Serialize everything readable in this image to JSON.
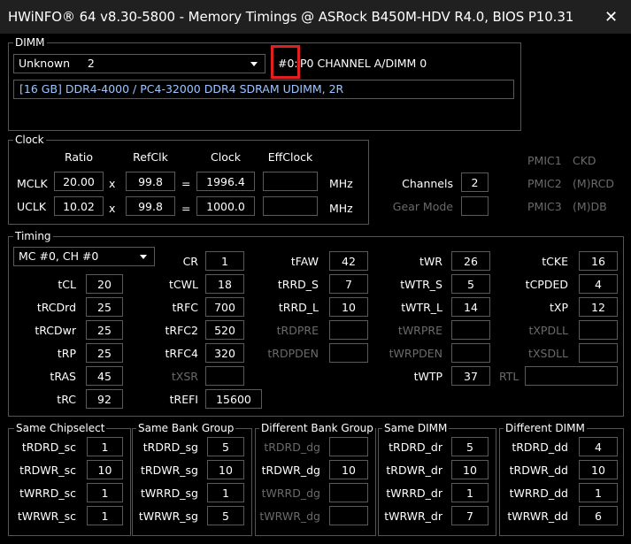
{
  "window": {
    "title": "HWiNFO® 64 v8.30-5800 - Memory Timings @ ASRock B450M-HDV R4.0, BIOS P10.31"
  },
  "dimm": {
    "group_label": "DIMM",
    "select_value": "Unknown     2",
    "slot_id": "#0:",
    "slot_name": "P0 CHANNEL A/DIMM 0",
    "info": "[16 GB] DDR4-4000 / PC4-32000 DDR4 SDRAM UDIMM, 2R"
  },
  "clock": {
    "group_label": "Clock",
    "headers": {
      "ratio": "Ratio",
      "refclk": "RefClk",
      "clock": "Clock",
      "effclock": "EffClock"
    },
    "mclk": {
      "label": "MCLK",
      "ratio": "20.00",
      "refclk": "99.8",
      "clock": "1996.4",
      "effclock": "",
      "unit": "MHz"
    },
    "uclk": {
      "label": "UCLK",
      "ratio": "10.02",
      "refclk": "99.8",
      "clock": "1000.0",
      "effclock": "",
      "unit": "MHz"
    },
    "x": "x",
    "eq": "=",
    "channels_label": "Channels",
    "channels_value": "2",
    "gear_label": "Gear Mode",
    "gear_value": "",
    "pmic1": "PMIC1",
    "pmic1_val": "CKD",
    "pmic2": "PMIC2",
    "pmic2_val": "(M)RCD",
    "pmic3": "PMIC3",
    "pmic3_val": "(M)DB"
  },
  "timing": {
    "group_label": "Timing",
    "mc_select": "MC #0, CH #0",
    "col1": [
      {
        "label": "tCL",
        "value": "20"
      },
      {
        "label": "tRCDrd",
        "value": "25"
      },
      {
        "label": "tRCDwr",
        "value": "25"
      },
      {
        "label": "tRP",
        "value": "25"
      },
      {
        "label": "tRAS",
        "value": "45"
      },
      {
        "label": "tRC",
        "value": "92"
      }
    ],
    "col2": [
      {
        "label": "CR",
        "value": "1"
      },
      {
        "label": "tCWL",
        "value": "18"
      },
      {
        "label": "tRFC",
        "value": "700"
      },
      {
        "label": "tRFC2",
        "value": "520"
      },
      {
        "label": "tRFC4",
        "value": "320"
      },
      {
        "label": "tXSR",
        "value": ""
      },
      {
        "label": "tREFI",
        "value": "15600"
      }
    ],
    "col3": [
      {
        "label": "tFAW",
        "value": "42"
      },
      {
        "label": "tRRD_S",
        "value": "7"
      },
      {
        "label": "tRRD_L",
        "value": "10"
      },
      {
        "label": "tRDPRE",
        "value": ""
      },
      {
        "label": "tRDPDEN",
        "value": ""
      }
    ],
    "col4": [
      {
        "label": "tWR",
        "value": "26"
      },
      {
        "label": "tWTR_S",
        "value": "5"
      },
      {
        "label": "tWTR_L",
        "value": "14"
      },
      {
        "label": "tWRPRE",
        "value": ""
      },
      {
        "label": "tWRPDEN",
        "value": ""
      },
      {
        "label": "tWTP",
        "value": "37"
      }
    ],
    "col5": [
      {
        "label": "tCKE",
        "value": "16"
      },
      {
        "label": "tCPDED",
        "value": "4"
      },
      {
        "label": "tXP",
        "value": "12"
      },
      {
        "label": "tXPDLL",
        "value": ""
      },
      {
        "label": "tXSDLL",
        "value": ""
      }
    ],
    "rtl_label": "RTL",
    "rtl_value": ""
  },
  "groups": [
    {
      "label": "Same Chipselect",
      "rows": [
        {
          "label": "tRDRD_sc",
          "value": "1"
        },
        {
          "label": "tRDWR_sc",
          "value": "10"
        },
        {
          "label": "tWRRD_sc",
          "value": "1"
        },
        {
          "label": "tWRWR_sc",
          "value": "1"
        }
      ]
    },
    {
      "label": "Same Bank Group",
      "rows": [
        {
          "label": "tRDRD_sg",
          "value": "5"
        },
        {
          "label": "tRDWR_sg",
          "value": "10"
        },
        {
          "label": "tWRRD_sg",
          "value": "1"
        },
        {
          "label": "tWRWR_sg",
          "value": "5"
        }
      ]
    },
    {
      "label": "Different Bank Group",
      "rows": [
        {
          "label": "tRDRD_dg",
          "value": ""
        },
        {
          "label": "tRDWR_dg",
          "value": "10"
        },
        {
          "label": "tWRRD_dg",
          "value": ""
        },
        {
          "label": "tWRWR_dg",
          "value": ""
        }
      ]
    },
    {
      "label": "Same DIMM",
      "rows": [
        {
          "label": "tRDRD_dr",
          "value": "5"
        },
        {
          "label": "tRDWR_dr",
          "value": "10"
        },
        {
          "label": "tWRRD_dr",
          "value": "1"
        },
        {
          "label": "tWRWR_dr",
          "value": "7"
        }
      ]
    },
    {
      "label": "Different DIMM",
      "rows": [
        {
          "label": "tRDRD_dd",
          "value": "4"
        },
        {
          "label": "tRDWR_dd",
          "value": "10"
        },
        {
          "label": "tWRRD_dd",
          "value": "1"
        },
        {
          "label": "tWRWR_dd",
          "value": "6"
        }
      ]
    }
  ]
}
